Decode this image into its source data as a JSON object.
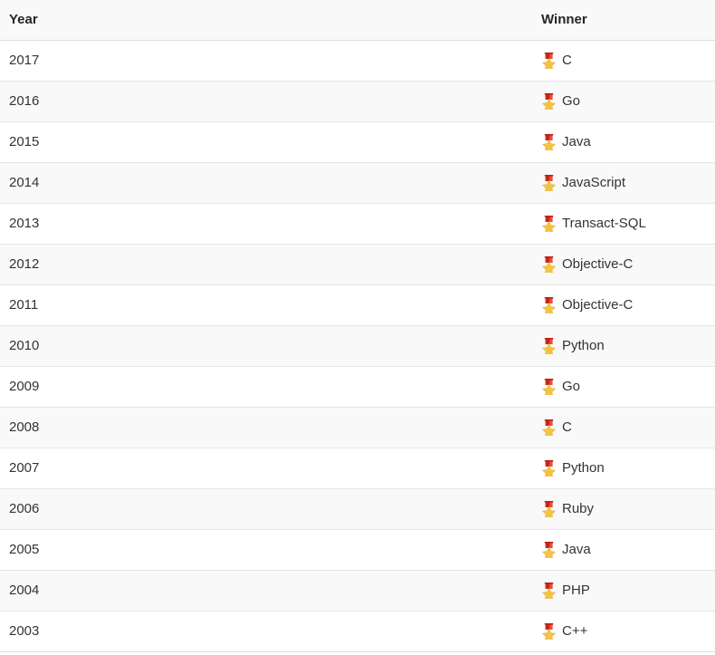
{
  "table": {
    "columns": [
      {
        "key": "year",
        "label": "Year"
      },
      {
        "key": "winner",
        "label": "Winner"
      }
    ],
    "icon": "military-medal-icon",
    "colors": {
      "header_background": "#f9f9f9",
      "header_text": "#262626",
      "row_background_odd": "#ffffff",
      "row_background_even": "#f9f9f9",
      "row_text": "#333333",
      "border": "#e6e6e6",
      "medal_ribbon": "#dd2e1f",
      "medal_star": "#f5c344"
    },
    "rows": [
      {
        "year": "2017",
        "winner": "C"
      },
      {
        "year": "2016",
        "winner": "Go"
      },
      {
        "year": "2015",
        "winner": "Java"
      },
      {
        "year": "2014",
        "winner": "JavaScript"
      },
      {
        "year": "2013",
        "winner": "Transact-SQL"
      },
      {
        "year": "2012",
        "winner": "Objective-C"
      },
      {
        "year": "2011",
        "winner": "Objective-C"
      },
      {
        "year": "2010",
        "winner": "Python"
      },
      {
        "year": "2009",
        "winner": "Go"
      },
      {
        "year": "2008",
        "winner": "C"
      },
      {
        "year": "2007",
        "winner": "Python"
      },
      {
        "year": "2006",
        "winner": "Ruby"
      },
      {
        "year": "2005",
        "winner": "Java"
      },
      {
        "year": "2004",
        "winner": "PHP"
      },
      {
        "year": "2003",
        "winner": "C++"
      }
    ]
  }
}
